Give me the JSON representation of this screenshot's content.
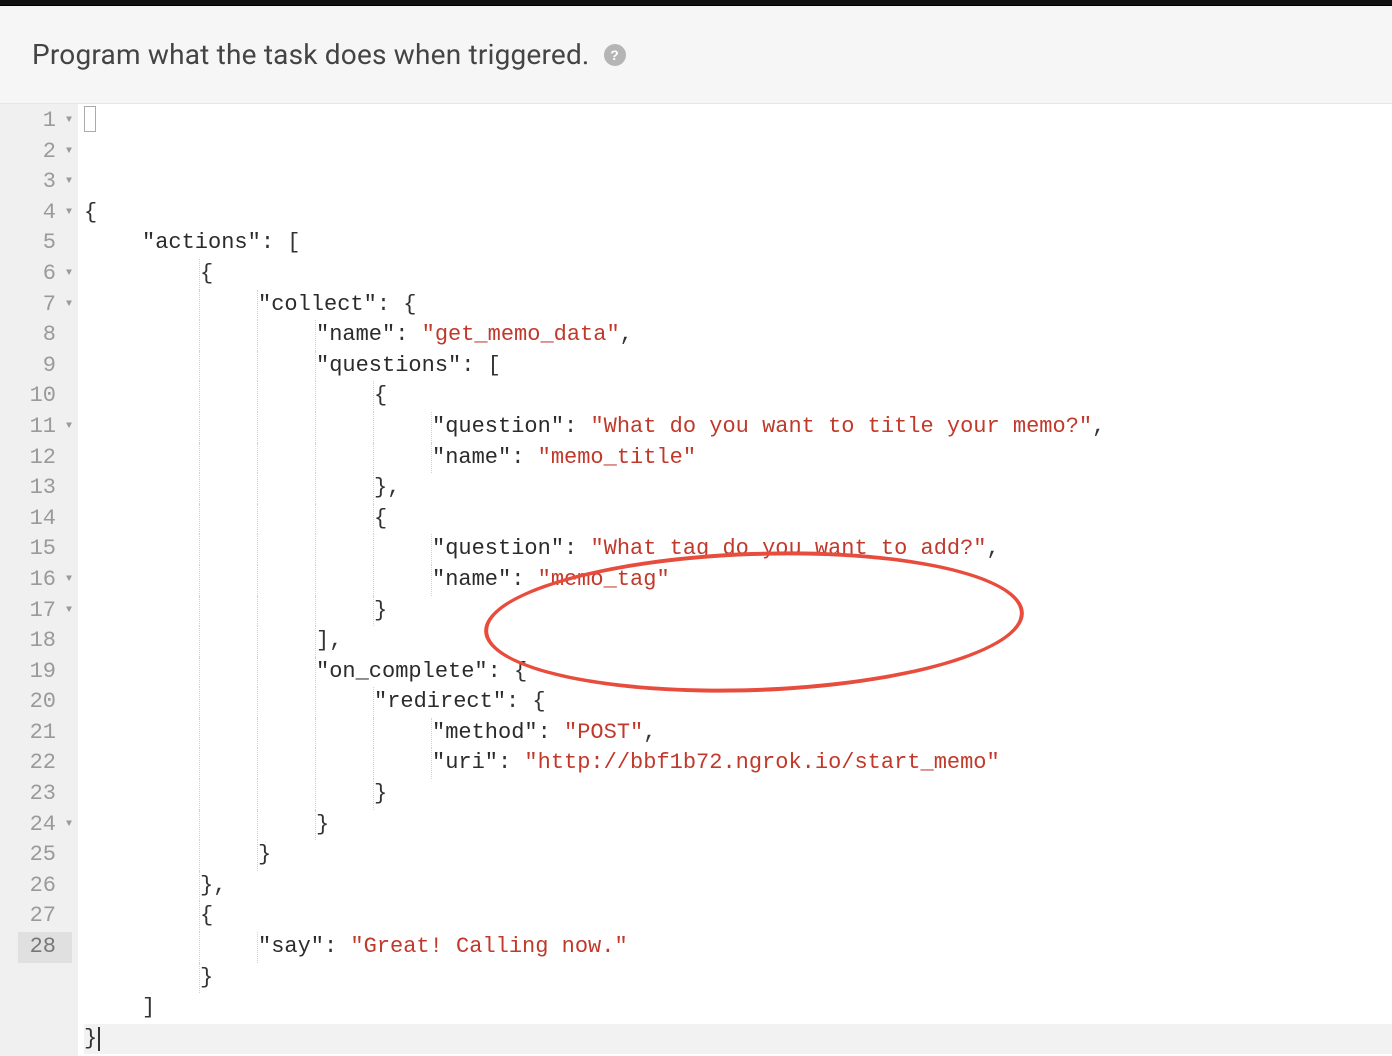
{
  "header": {
    "title": "Program what the task does when triggered.",
    "help_tooltip": "?"
  },
  "gutter": {
    "fold_lines": [
      1,
      2,
      3,
      4,
      6,
      7,
      11,
      16,
      17,
      24
    ],
    "active_line": 28,
    "total_lines": 28
  },
  "code": {
    "lines": [
      [
        {
          "t": "punct",
          "v": "{"
        }
      ],
      [
        {
          "t": "indent",
          "n": 1
        },
        {
          "t": "key",
          "v": "\"actions\""
        },
        {
          "t": "punct",
          "v": ": ["
        }
      ],
      [
        {
          "t": "indent",
          "n": 2
        },
        {
          "t": "punct",
          "v": "{"
        }
      ],
      [
        {
          "t": "indent",
          "n": 3
        },
        {
          "t": "key",
          "v": "\"collect\""
        },
        {
          "t": "punct",
          "v": ": {"
        }
      ],
      [
        {
          "t": "indent",
          "n": 4
        },
        {
          "t": "key",
          "v": "\"name\""
        },
        {
          "t": "punct",
          "v": ": "
        },
        {
          "t": "str",
          "v": "\"get_memo_data\""
        },
        {
          "t": "punct",
          "v": ","
        }
      ],
      [
        {
          "t": "indent",
          "n": 4
        },
        {
          "t": "key",
          "v": "\"questions\""
        },
        {
          "t": "punct",
          "v": ": ["
        }
      ],
      [
        {
          "t": "indent",
          "n": 5
        },
        {
          "t": "punct",
          "v": "{"
        }
      ],
      [
        {
          "t": "indent",
          "n": 6
        },
        {
          "t": "key",
          "v": "\"question\""
        },
        {
          "t": "punct",
          "v": ": "
        },
        {
          "t": "str",
          "v": "\"What do you want to title your memo?\""
        },
        {
          "t": "punct",
          "v": ","
        }
      ],
      [
        {
          "t": "indent",
          "n": 6
        },
        {
          "t": "key",
          "v": "\"name\""
        },
        {
          "t": "punct",
          "v": ": "
        },
        {
          "t": "str",
          "v": "\"memo_title\""
        }
      ],
      [
        {
          "t": "indent",
          "n": 5
        },
        {
          "t": "punct",
          "v": "},"
        }
      ],
      [
        {
          "t": "indent",
          "n": 5
        },
        {
          "t": "punct",
          "v": "{"
        }
      ],
      [
        {
          "t": "indent",
          "n": 6
        },
        {
          "t": "key",
          "v": "\"question\""
        },
        {
          "t": "punct",
          "v": ": "
        },
        {
          "t": "str",
          "v": "\"What tag do you want to add?\""
        },
        {
          "t": "punct",
          "v": ","
        }
      ],
      [
        {
          "t": "indent",
          "n": 6
        },
        {
          "t": "key",
          "v": "\"name\""
        },
        {
          "t": "punct",
          "v": ": "
        },
        {
          "t": "str",
          "v": "\"memo_tag\""
        }
      ],
      [
        {
          "t": "indent",
          "n": 5
        },
        {
          "t": "punct",
          "v": "}"
        }
      ],
      [
        {
          "t": "indent",
          "n": 4
        },
        {
          "t": "punct",
          "v": "],"
        }
      ],
      [
        {
          "t": "indent",
          "n": 4
        },
        {
          "t": "key",
          "v": "\"on_complete\""
        },
        {
          "t": "punct",
          "v": ": {"
        }
      ],
      [
        {
          "t": "indent",
          "n": 5
        },
        {
          "t": "key",
          "v": "\"redirect\""
        },
        {
          "t": "punct",
          "v": ": {"
        }
      ],
      [
        {
          "t": "indent",
          "n": 6
        },
        {
          "t": "key",
          "v": "\"method\""
        },
        {
          "t": "punct",
          "v": ": "
        },
        {
          "t": "str",
          "v": "\"POST\""
        },
        {
          "t": "punct",
          "v": ","
        }
      ],
      [
        {
          "t": "indent",
          "n": 6
        },
        {
          "t": "key",
          "v": "\"uri\""
        },
        {
          "t": "punct",
          "v": ": "
        },
        {
          "t": "str",
          "v": "\"http://bbf1b72.ngrok.io/start_memo\""
        }
      ],
      [
        {
          "t": "indent",
          "n": 5
        },
        {
          "t": "punct",
          "v": "}"
        }
      ],
      [
        {
          "t": "indent",
          "n": 4
        },
        {
          "t": "punct",
          "v": "}"
        }
      ],
      [
        {
          "t": "indent",
          "n": 3
        },
        {
          "t": "punct",
          "v": "}"
        }
      ],
      [
        {
          "t": "indent",
          "n": 2
        },
        {
          "t": "punct",
          "v": "},"
        }
      ],
      [
        {
          "t": "indent",
          "n": 2
        },
        {
          "t": "punct",
          "v": "{"
        }
      ],
      [
        {
          "t": "indent",
          "n": 3
        },
        {
          "t": "key",
          "v": "\"say\""
        },
        {
          "t": "punct",
          "v": ": "
        },
        {
          "t": "str",
          "v": "\"Great! Calling now.\""
        }
      ],
      [
        {
          "t": "indent",
          "n": 2
        },
        {
          "t": "punct",
          "v": "}"
        }
      ],
      [
        {
          "t": "indent",
          "n": 1
        },
        {
          "t": "punct",
          "v": "]"
        }
      ],
      [
        {
          "t": "punct",
          "v": "}"
        },
        {
          "t": "caret"
        }
      ]
    ]
  }
}
